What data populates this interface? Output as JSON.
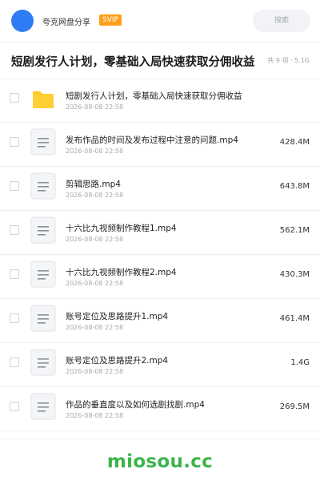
{
  "app": {
    "site_name": "夸克网盘分享",
    "badge": "SVIP",
    "search_placeholder": "搜索",
    "accent_color": "#2f7cf6",
    "badge_color": "#ff9f1c"
  },
  "share": {
    "title": "短剧发行人计划，零基础入局快速获取分佣收益",
    "meta": "共 9 项 · 5.1G"
  },
  "files": [
    {
      "icon": "folder-icon",
      "name": "短剧发行人计划，零基础入局快速获取分佣收益",
      "date": "2026-08-08 22:58",
      "size": ""
    },
    {
      "icon": "document-icon",
      "name": "发布作品的时间及发布过程中注意的问题.mp4",
      "date": "2026-08-08 22:58",
      "size": "428.4M"
    },
    {
      "icon": "document-icon",
      "name": "剪辑思路.mp4",
      "date": "2026-08-08 22:58",
      "size": "643.8M"
    },
    {
      "icon": "document-icon",
      "name": "十六比九视频制作教程1.mp4",
      "date": "2026-08-08 22:58",
      "size": "562.1M"
    },
    {
      "icon": "document-icon",
      "name": "十六比九视频制作教程2.mp4",
      "date": "2026-08-08 22:58",
      "size": "430.3M"
    },
    {
      "icon": "document-icon",
      "name": "账号定位及思路提升1.mp4",
      "date": "2026-08-08 22:58",
      "size": "461.4M"
    },
    {
      "icon": "document-icon",
      "name": "账号定位及思路提升2.mp4",
      "date": "2026-08-08 22:58",
      "size": "1.4G"
    },
    {
      "icon": "document-icon",
      "name": "作品的垂直度以及如何选剧找剧.mp4",
      "date": "2026-08-08 22:58",
      "size": "269.5M"
    }
  ],
  "watermark": "miosou.cc"
}
